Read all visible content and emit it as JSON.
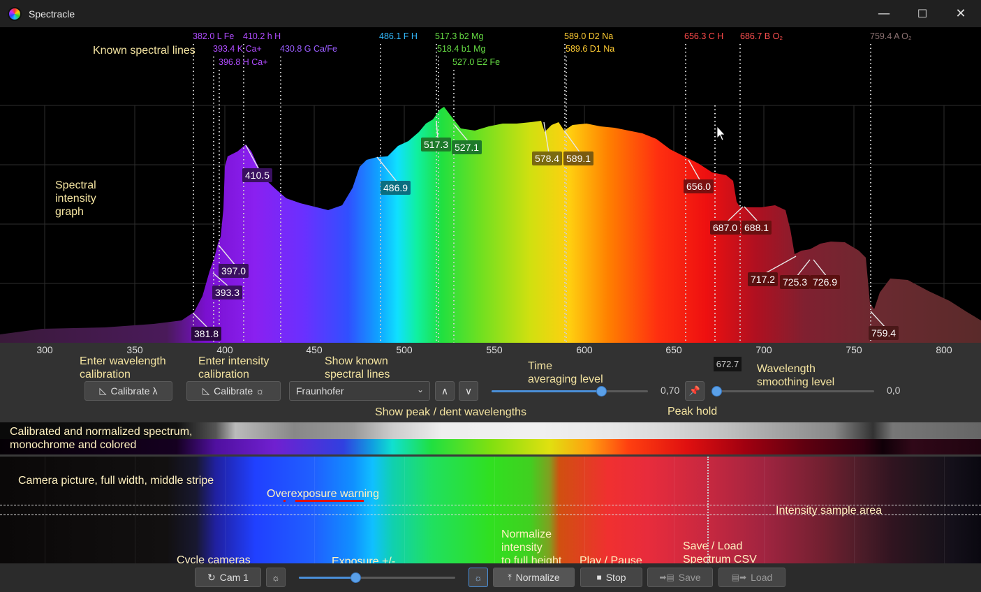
{
  "window": {
    "title": "Spectracle",
    "minimize_glyph": "—",
    "maximize_glyph": "☐",
    "close_glyph": "✕"
  },
  "known_lines": [
    {
      "label": "382.0 L Fe",
      "color": "#b04cff"
    },
    {
      "label": "393.4 K Ca+",
      "color": "#b04cff"
    },
    {
      "label": "396.8 H Ca+",
      "color": "#b04cff"
    },
    {
      "label": "410.2 h H",
      "color": "#b04cff"
    },
    {
      "label": "430.8 G Ca/Fe",
      "color": "#9a5cff"
    },
    {
      "label": "486.1 F H",
      "color": "#33bbff"
    },
    {
      "label": "517.3 b2 Mg",
      "color": "#66dd44"
    },
    {
      "label": "518.4 b1 Mg",
      "color": "#66dd44"
    },
    {
      "label": "527.0 E2 Fe",
      "color": "#66dd44"
    },
    {
      "label": "589.0 D2 Na",
      "color": "#ffcc33"
    },
    {
      "label": "589.6 D1 Na",
      "color": "#ffcc33"
    },
    {
      "label": "656.3 C H",
      "color": "#ff4a4a"
    },
    {
      "label": "686.7 B O₂",
      "color": "#ff5050"
    },
    {
      "label": "759.4 A O₂",
      "color": "#8a7070"
    }
  ],
  "peak_labels": [
    {
      "label": "381.8",
      "color": "#2a0840"
    },
    {
      "label": "393.3",
      "color": "#3a1060"
    },
    {
      "label": "397.0",
      "color": "#3a1060"
    },
    {
      "label": "410.5",
      "color": "#3a1060"
    },
    {
      "label": "486.9",
      "color": "#0b6e80"
    },
    {
      "label": "517.3",
      "color": "#1e7a2a"
    },
    {
      "label": "527.1",
      "color": "#1e7a2a"
    },
    {
      "label": "578.4",
      "color": "#7a6a10"
    },
    {
      "label": "589.1",
      "color": "#7a5a10"
    },
    {
      "label": "656.0",
      "color": "#7a1010"
    },
    {
      "label": "687.0",
      "color": "#6a1010"
    },
    {
      "label": "688.1",
      "color": "#6a1010"
    },
    {
      "label": "717.2",
      "color": "#5a1010"
    },
    {
      "label": "725.3",
      "color": "#5a1010"
    },
    {
      "label": "726.9",
      "color": "#5a1010"
    },
    {
      "label": "759.4",
      "color": "#4a1818"
    }
  ],
  "axis": {
    "ticks": [
      "300",
      "350",
      "400",
      "450",
      "500",
      "550",
      "600",
      "650",
      "700",
      "750",
      "800"
    ],
    "cursor_value": "672.7"
  },
  "annotations": {
    "known_lines": "Known spectral lines",
    "graph": "Spectral\nintensity\ngraph",
    "wavelength_cal": "Enter wavelength\ncalibration",
    "intensity_cal": "Enter intensity\ncalibration",
    "show_lines": "Show known\nspectral lines",
    "time_avg": "Time\naveraging level",
    "wl_smooth": "Wavelength\nsmoothing level",
    "show_peak": "Show peak / dent wavelengths",
    "peak_hold": "Peak hold",
    "calibrated": "Calibrated and normalized spectrum,\nmonochrome and colored",
    "camera": "Camera picture, full width, middle stripe",
    "overexposure": "Overexposure warning",
    "sample_area": "Intensity sample area",
    "normalize": "Normalize\nintensity\nto full height",
    "play_pause": "Play / Pause",
    "save_load": "Save / Load\nSpectrum CSV",
    "cycle_cams": "Cycle cameras",
    "exposure": "Exposure +/-"
  },
  "controls": {
    "calibrate_wl": "Calibrate λ",
    "calibrate_int": "Calibrate ☼",
    "fraunhofer_select": "Fraunhofer",
    "peak_up": "∧",
    "peak_down": "∨",
    "time_avg_value": "0,70",
    "time_avg_level": 0.7,
    "smooth_value": "0,0",
    "smooth_level": 0.0,
    "exposure_level": 0.36
  },
  "toolbar": {
    "cam": "Cam 1",
    "normalize": "Normalize",
    "stop": "Stop",
    "save": "Save",
    "load": "Load"
  }
}
